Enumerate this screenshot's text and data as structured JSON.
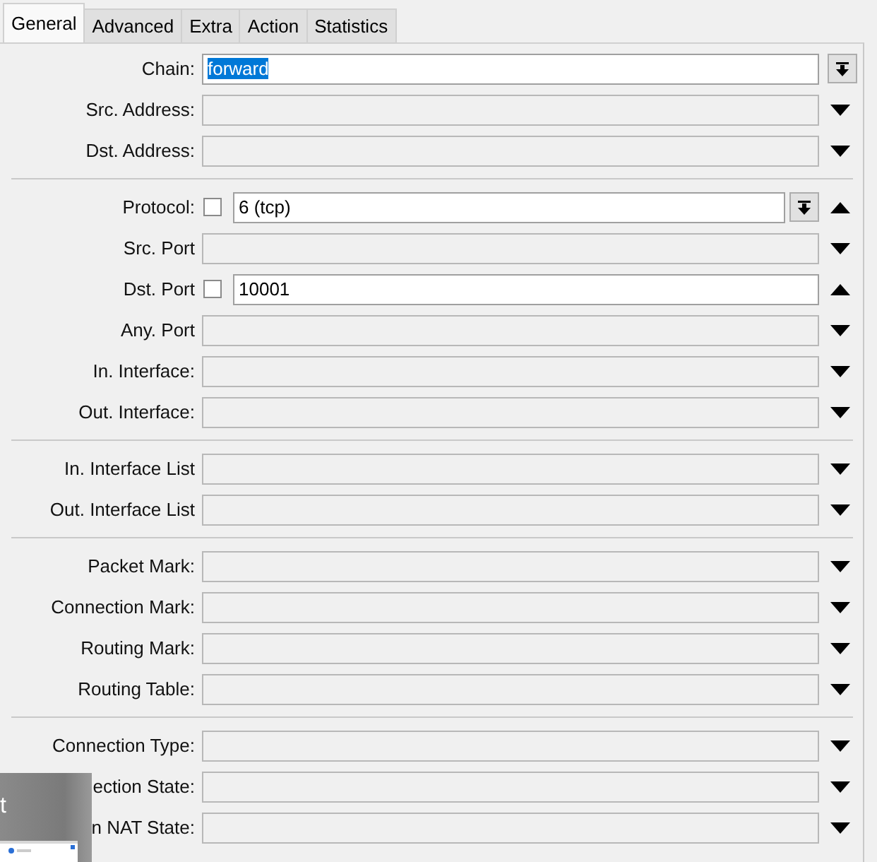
{
  "tabs": [
    {
      "label": "General",
      "selected": true
    },
    {
      "label": "Advanced",
      "selected": false
    },
    {
      "label": "Extra",
      "selected": false
    },
    {
      "label": "Action",
      "selected": false
    },
    {
      "label": "Statistics",
      "selected": false
    }
  ],
  "sections": [
    {
      "rows": [
        {
          "label": "Chain:",
          "value": "forward",
          "value_selected": true,
          "enabled": true,
          "combo": true
        },
        {
          "label": "Src. Address:",
          "enabled": false,
          "expanded": false
        },
        {
          "label": "Dst. Address:",
          "enabled": false,
          "expanded": false
        }
      ]
    },
    {
      "rows": [
        {
          "label": "Protocol:",
          "negate": false,
          "value": "6 (tcp)",
          "enabled": true,
          "combo": true,
          "expanded": true
        },
        {
          "label": "Src. Port",
          "enabled": false,
          "expanded": false
        },
        {
          "label": "Dst. Port",
          "negate": false,
          "value": "10001",
          "enabled": true,
          "expanded": true
        },
        {
          "label": "Any. Port",
          "enabled": false,
          "expanded": false
        },
        {
          "label": "In. Interface:",
          "enabled": false,
          "expanded": false
        },
        {
          "label": "Out. Interface:",
          "enabled": false,
          "expanded": false
        }
      ]
    },
    {
      "rows": [
        {
          "label": "In. Interface List",
          "enabled": false,
          "expanded": false
        },
        {
          "label": "Out. Interface List",
          "enabled": false,
          "expanded": false
        }
      ]
    },
    {
      "rows": [
        {
          "label": "Packet Mark:",
          "enabled": false,
          "expanded": false
        },
        {
          "label": "Connection Mark:",
          "enabled": false,
          "expanded": false
        },
        {
          "label": "Routing Mark:",
          "enabled": false,
          "expanded": false
        },
        {
          "label": "Routing Table:",
          "enabled": false,
          "expanded": false
        }
      ]
    },
    {
      "rows": [
        {
          "label": "Connection Type:",
          "enabled": false,
          "expanded": false
        },
        {
          "label": "ection State:",
          "enabled": false,
          "expanded": false
        },
        {
          "label": "n NAT State:",
          "enabled": false,
          "expanded": false
        }
      ]
    }
  ],
  "overlay": {
    "title": "t"
  }
}
